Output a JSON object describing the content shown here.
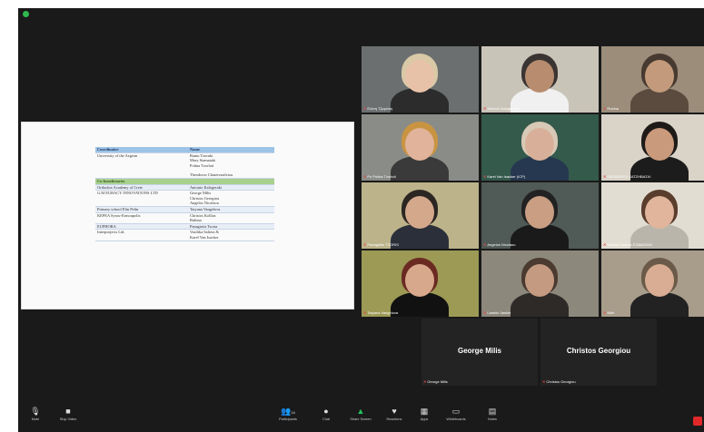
{
  "share": {
    "table": {
      "header": [
        "Coordinator",
        "Name"
      ],
      "rows": [
        {
          "org": "University of the Aegean",
          "names": [
            "Ramu Tzoraki",
            "Mary Stamataki",
            "Polina Tzorloti",
            "Theodoros Chatzivasileiou"
          ],
          "style": "plain"
        },
        {
          "org": "Co-beneficiaries",
          "names": [
            ""
          ],
          "style": "sub"
        },
        {
          "org": "Orthodox Academy of Crete",
          "names": [
            "Antonio Kalogeraki"
          ],
          "style": "alt"
        },
        {
          "org": "G.M EURACY INNOVATIONS LTD",
          "names": [
            "George Milis",
            "Christos Georgiou",
            "Angelos Nicolaou"
          ],
          "style": "plain"
        },
        {
          "org": "Primary school Elin Pelin",
          "names": [
            "Tatyana Vangelova"
          ],
          "style": "alt"
        },
        {
          "org": "KEPEA Syrou-Ermoupolis",
          "names": [
            "Christos Kollias",
            "Rubina"
          ],
          "style": "plain"
        },
        {
          "org": "EUPHORA",
          "names": [
            "Panagiotis Tsoria"
          ],
          "style": "alt"
        },
        {
          "org": "Interprojects Ltd.",
          "names": [
            "Vasilika Saliera &",
            "Karel Van Isacker"
          ],
          "style": "plain"
        }
      ]
    }
  },
  "participants": [
    {
      "label": "Ελένη Τζωράκη"
    },
    {
      "label": "Antonis Kalogerakis"
    },
    {
      "label": "Rubina"
    },
    {
      "label": "Po Polina Tzorloti"
    },
    {
      "label": "Karel Van Isacker (ICP)"
    },
    {
      "label": "ΘΕΟΔΩΡΟΣ ΧΑΤΖΗΒΑΣΙΛ"
    },
    {
      "label": "Panagiotis TSORIS"
    },
    {
      "label": "Angelos Nicolaou"
    },
    {
      "label": "Vasilika Saliera STAMATAKI"
    },
    {
      "label": "Tatyana Vangelova"
    },
    {
      "label": "Lambis Vankie"
    },
    {
      "label": "Nikh"
    }
  ],
  "name_tiles": [
    {
      "big": "George Milis",
      "label": "George Milis"
    },
    {
      "big": "Christos Georgiou",
      "label": "Christos Georgiou"
    }
  ],
  "toolbar": {
    "mute": "Mute",
    "video": "Stop Video",
    "participants": "Participants",
    "participants_count": "16",
    "chat": "Chat",
    "share": "Share Screen",
    "reactions": "Reactions",
    "apps": "Apps",
    "whiteboards": "Whiteboards",
    "notes": "Notes"
  },
  "colors": {
    "share_active": "#22c55e",
    "end": "#e02828",
    "muted": "#e34b4b"
  }
}
